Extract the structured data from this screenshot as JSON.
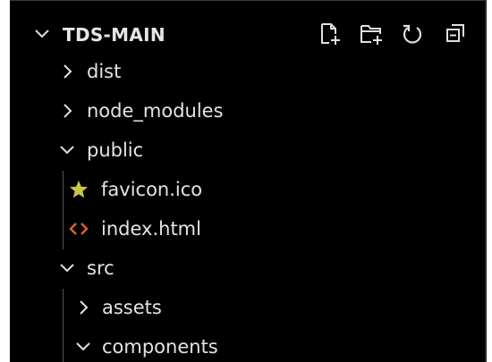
{
  "explorer": {
    "title": "TDS-MAIN",
    "actions": [
      {
        "name": "new-file",
        "icon": "new-file-icon"
      },
      {
        "name": "new-folder",
        "icon": "new-folder-icon"
      },
      {
        "name": "refresh",
        "icon": "refresh-icon"
      },
      {
        "name": "collapse-all",
        "icon": "collapse-all-icon"
      }
    ],
    "tree": [
      {
        "label": "dist",
        "type": "folder",
        "expanded": false,
        "depth": 1
      },
      {
        "label": "node_modules",
        "type": "folder",
        "expanded": false,
        "depth": 1
      },
      {
        "label": "public",
        "type": "folder",
        "expanded": true,
        "depth": 1
      },
      {
        "label": "favicon.ico",
        "type": "file",
        "icon": "star-icon",
        "depth": 2
      },
      {
        "label": "index.html",
        "type": "file",
        "icon": "html-code-icon",
        "depth": 2
      },
      {
        "label": "src",
        "type": "folder",
        "expanded": true,
        "depth": 1
      },
      {
        "label": "assets",
        "type": "folder",
        "expanded": false,
        "depth": 2
      },
      {
        "label": "components",
        "type": "folder",
        "expanded": true,
        "depth": 2
      }
    ]
  },
  "colors": {
    "background": "#000000",
    "text": "#e4e4e4",
    "star": "#c9c64a",
    "html_icon": "#e0622d",
    "guide": "#555555"
  }
}
